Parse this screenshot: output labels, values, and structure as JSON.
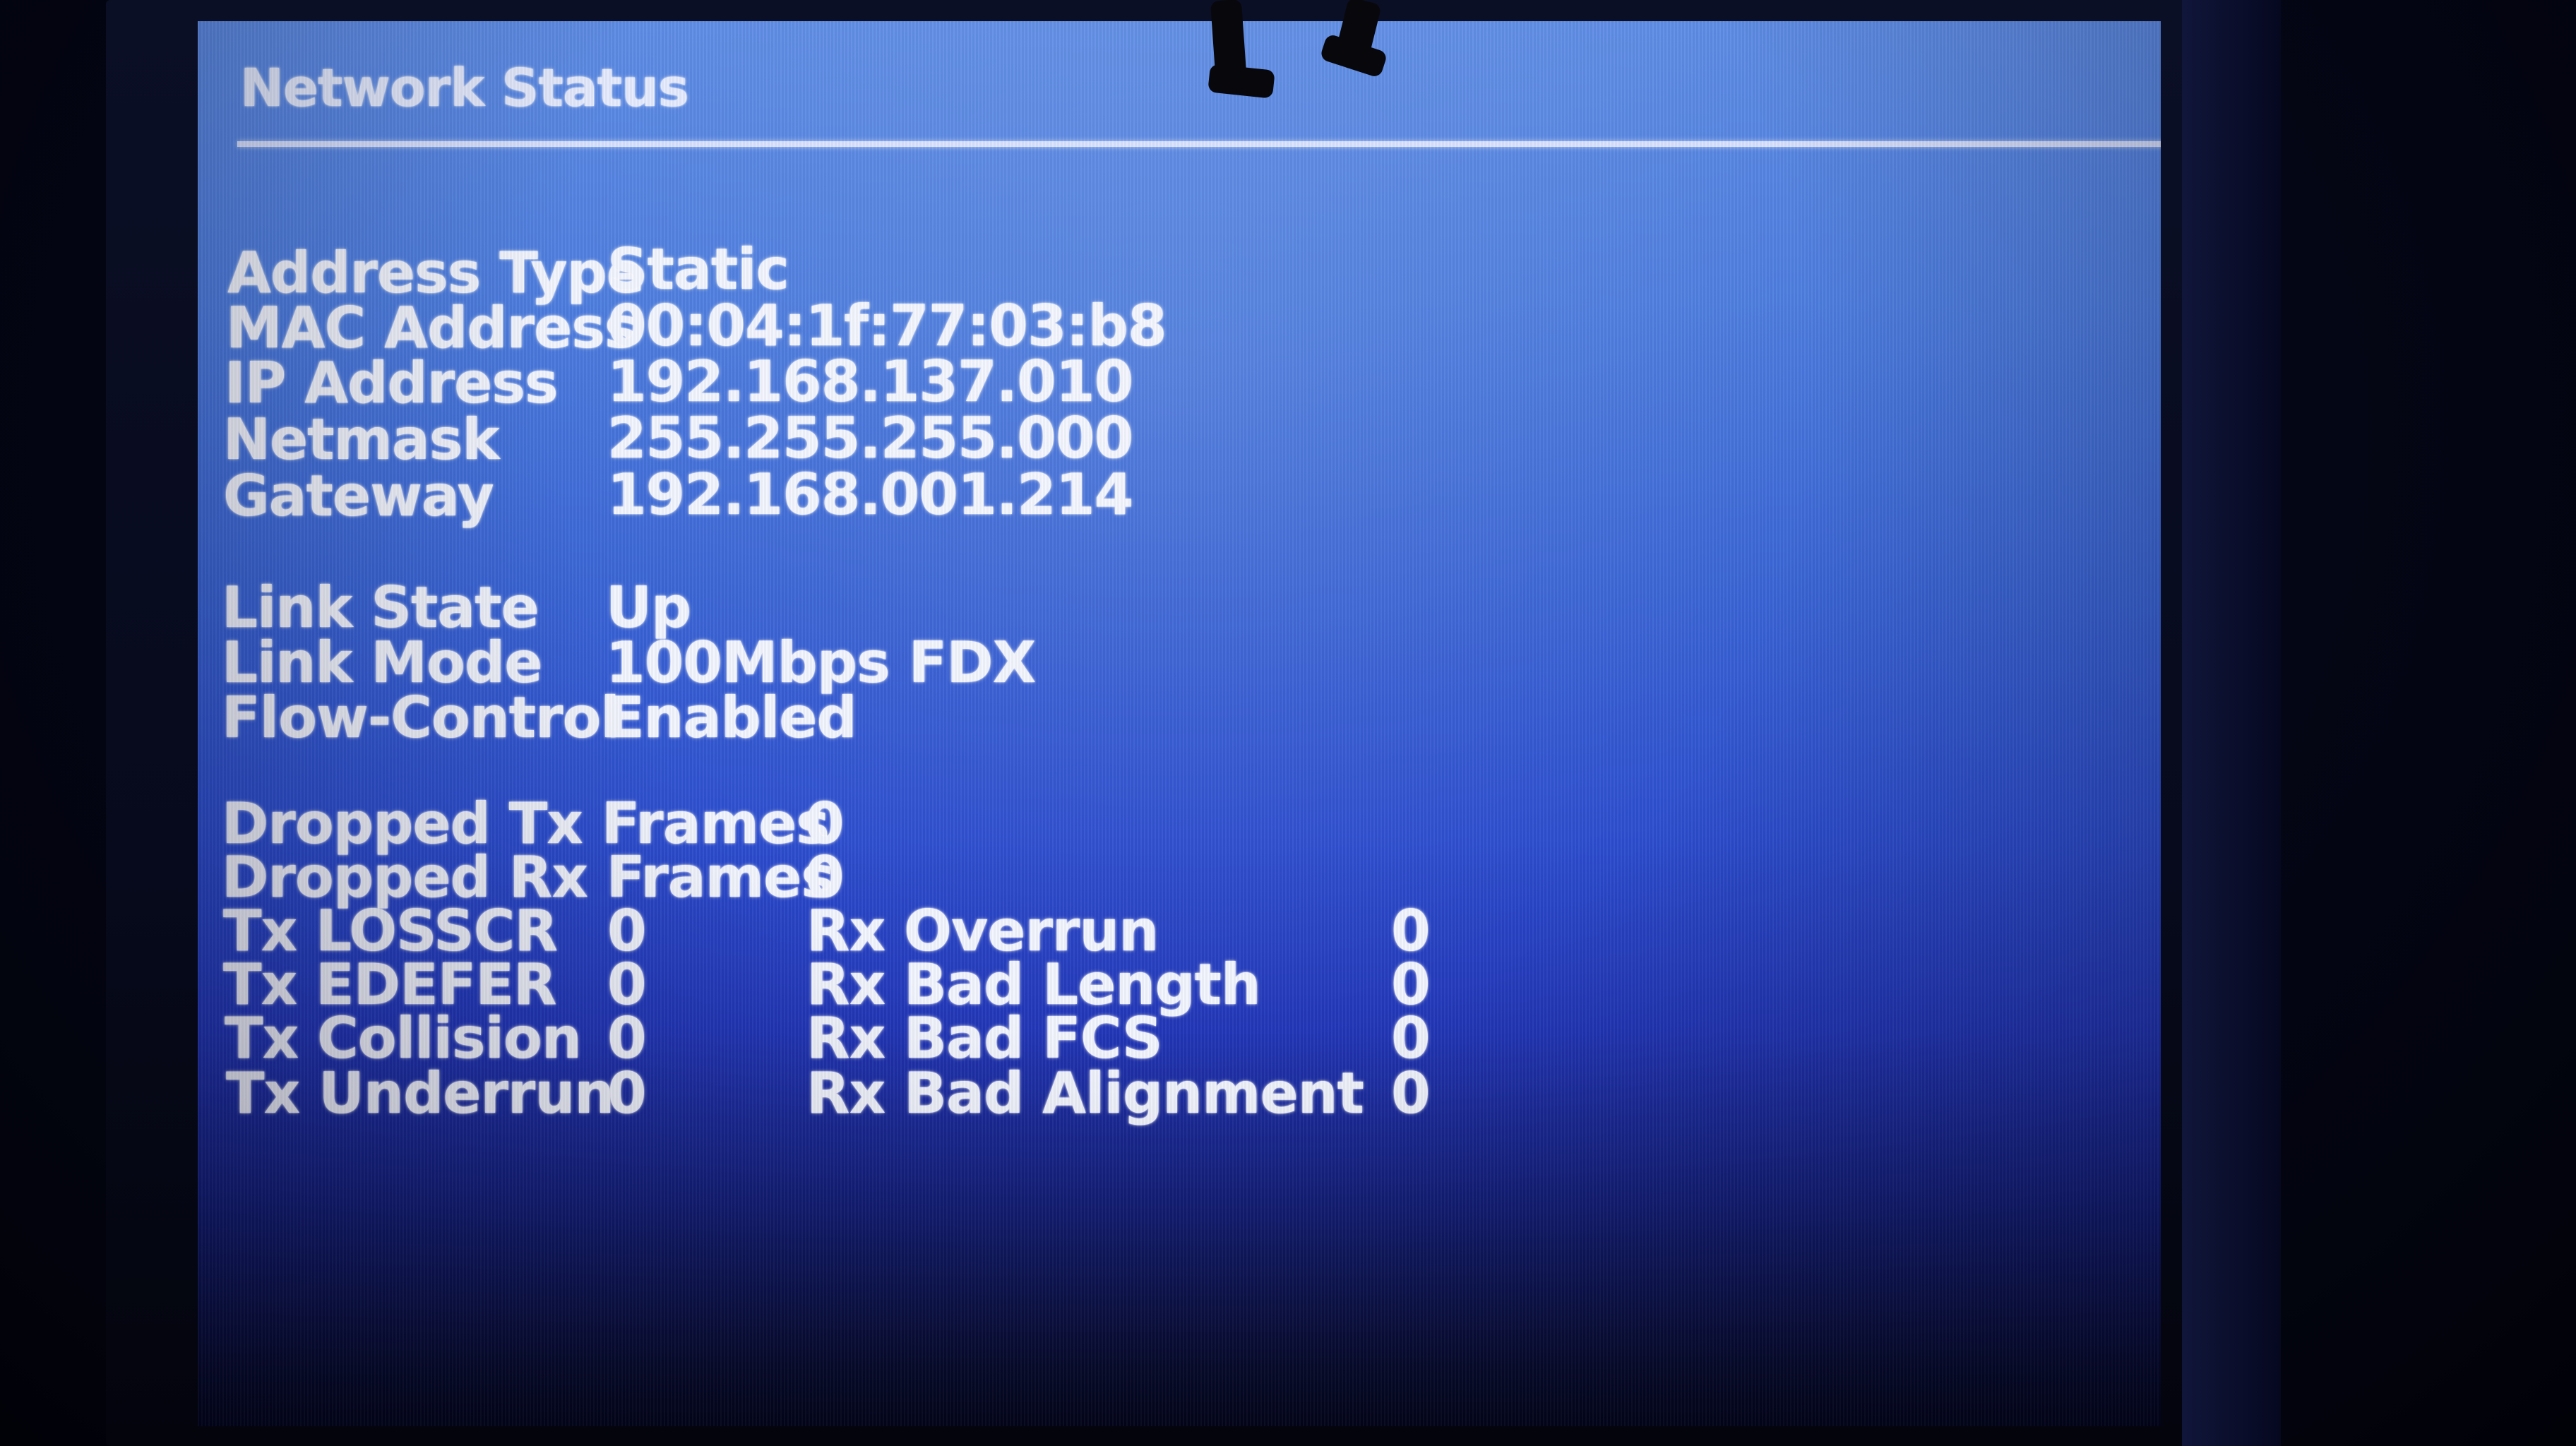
{
  "screen": {
    "title": "Network Status",
    "colors": {
      "screen_top": "#5f8de6",
      "screen_bottom": "#03051a",
      "text": "#f4f6ff"
    }
  },
  "address": [
    {
      "label": "Address Type",
      "value": "Static"
    },
    {
      "label": "MAC Address",
      "value": "00:04:1f:77:03:b8"
    },
    {
      "label": "IP Address",
      "value": "192.168.137.010"
    },
    {
      "label": "Netmask",
      "value": "255.255.255.000"
    },
    {
      "label": "Gateway",
      "value": "192.168.001.214"
    }
  ],
  "link": [
    {
      "label": "Link State",
      "value": "Up"
    },
    {
      "label": "Link Mode",
      "value": "100Mbps FDX"
    },
    {
      "label": "Flow-Control",
      "value": "Enabled"
    }
  ],
  "dropped": [
    {
      "label": "Dropped Tx Frames",
      "value": "0"
    },
    {
      "label": "Dropped Rx Frames",
      "value": "0"
    }
  ],
  "counters": [
    {
      "tx_label": "Tx LOSSCR",
      "tx_value": "0",
      "rx_label": "Rx Overrun",
      "rx_value": "0"
    },
    {
      "tx_label": "Tx EDEFER",
      "tx_value": "0",
      "rx_label": "Rx Bad Length",
      "rx_value": "0"
    },
    {
      "tx_label": "Tx Collision",
      "tx_value": "0",
      "rx_label": "Rx Bad FCS",
      "rx_value": "0"
    },
    {
      "tx_label": "Tx Underrun",
      "tx_value": "0",
      "rx_label": "Rx Bad Alignment",
      "rx_value": "0"
    }
  ]
}
